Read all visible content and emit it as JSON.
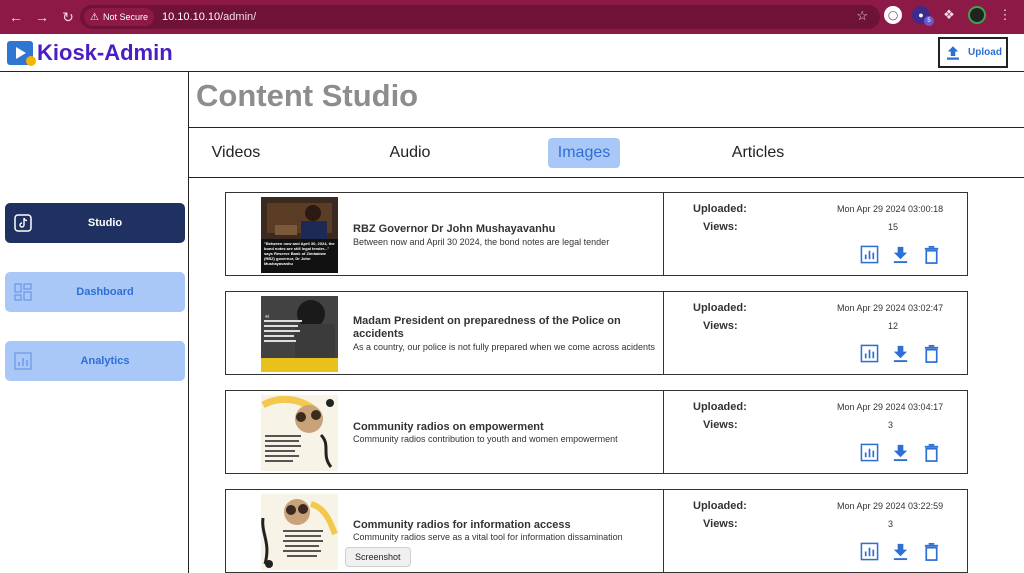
{
  "browser": {
    "security_label": "Not Secure",
    "url_host": "10.10.10.10",
    "url_path": "/admin/",
    "extension_badge": "5",
    "colors": {
      "frame": "#8c1946",
      "omnibox": "#6e1236"
    }
  },
  "header": {
    "app_name": "Kiosk-Admin",
    "upload_label": "Upload",
    "logo_icon": "play-icon"
  },
  "sidebar": {
    "items": [
      {
        "label": "Studio",
        "icon": "tiktok-icon",
        "active": true
      },
      {
        "label": "Dashboard",
        "icon": "dashboard-icon",
        "active": false
      },
      {
        "label": "Analytics",
        "icon": "analytics-icon",
        "active": false
      }
    ]
  },
  "main": {
    "title": "Content Studio",
    "tabs": [
      {
        "label": "Videos",
        "active": false
      },
      {
        "label": "Audio",
        "active": false
      },
      {
        "label": "Images",
        "active": true
      },
      {
        "label": "Articles",
        "active": false
      }
    ],
    "meta_labels": {
      "uploaded": "Uploaded:",
      "views": "Views:"
    },
    "items": [
      {
        "title": "RBZ Governor Dr John Mushayavanhu",
        "description": "Between now and April 30 2024, the bond notes are legal tender",
        "uploaded": "Mon Apr 29 2024 03:00:18",
        "views": "15",
        "thumb_text": "\"Between now and April 30, 2024, the bond notes are still legal tender...\" says Reserve Bank of Zimbabwe (RBZ) governor, Dr John Mushayavanhu"
      },
      {
        "title": "Madam President on preparedness of the Police on accidents",
        "description": "As a country, our police is not fully prepared when we come across acidents",
        "uploaded": "Mon Apr 29 2024 03:02:47",
        "views": "12"
      },
      {
        "title": "Community radios on empowerment",
        "description": "Community radios contribution to youth and women empowerment",
        "uploaded": "Mon Apr 29 2024 03:04:17",
        "views": "3"
      },
      {
        "title": "Community radios for information access",
        "description": "Community radios serve as a vital tool for information dissamination",
        "uploaded": "Mon Apr 29 2024 03:22:59",
        "views": "3"
      }
    ]
  },
  "tooltip": {
    "text": "Screenshot"
  },
  "colors": {
    "accent": "#2e6fd6",
    "active_bg": "#a9c8f7",
    "studio_bg": "#1e3160",
    "brand_purple": "#4a1ec0"
  }
}
